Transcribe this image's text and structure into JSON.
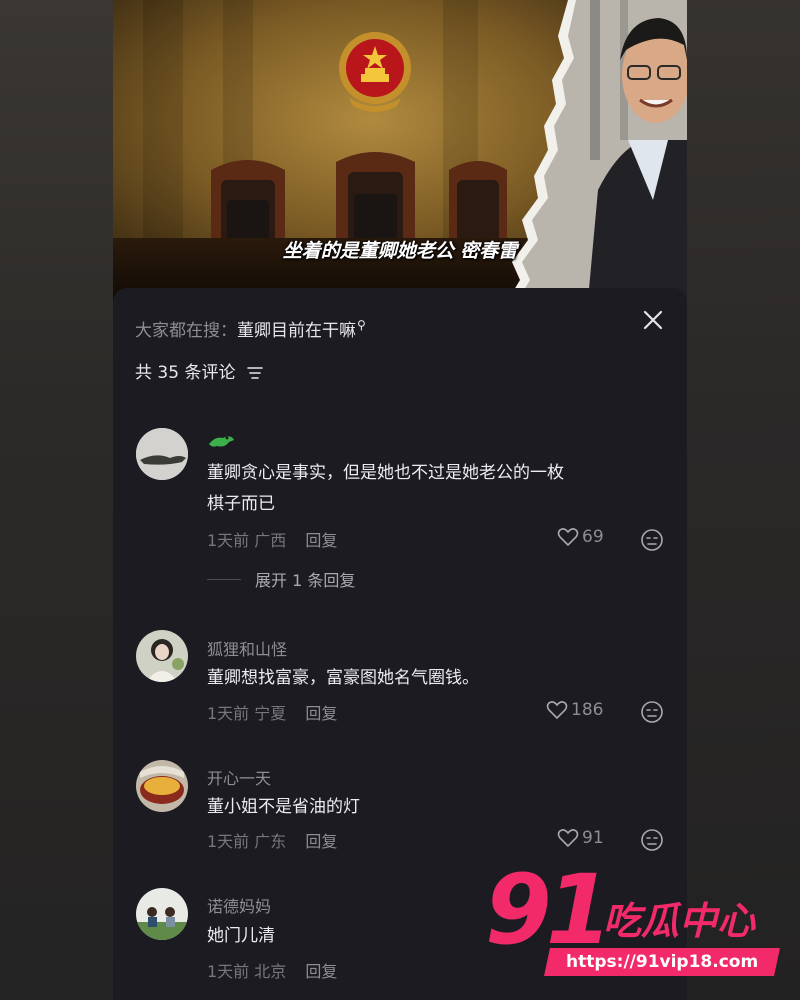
{
  "video": {
    "subtitle": "坐着的是董卿她老公 密春雷"
  },
  "search": {
    "prefix": "大家都在搜：",
    "query": "董卿目前在干嘛",
    "icon": "search-icon"
  },
  "comments_header": {
    "count_label": "共 35 条评论",
    "filter_icon": "filter-icon",
    "close_icon": "close-icon"
  },
  "comments": [
    {
      "username": "",
      "text": "董卿贪心是事实，但是她也不过是她老公的一枚棋子而已",
      "time": "1天前",
      "location": "广西",
      "reply_label": "回复",
      "likes": "69",
      "expand_label": "展开 1 条回复"
    },
    {
      "username": "狐狸和山怪",
      "text": "董卿想找富豪，富豪图她名气圈钱。",
      "time": "1天前",
      "location": "宁夏",
      "reply_label": "回复",
      "likes": "186"
    },
    {
      "username": "开心一天",
      "text": "董小姐不是省油的灯",
      "time": "1天前",
      "location": "广东",
      "reply_label": "回复",
      "likes": "91"
    },
    {
      "username": "诺德妈妈",
      "text": "她门儿清",
      "time": "1天前",
      "location": "北京",
      "reply_label": "回复",
      "likes": ""
    }
  ],
  "watermark": {
    "number": "91",
    "name": "吃瓜中心",
    "url": "https://91vip18.com"
  },
  "colors": {
    "sheet_bg": "#1b1b21",
    "watermark": "#f22a6a"
  }
}
